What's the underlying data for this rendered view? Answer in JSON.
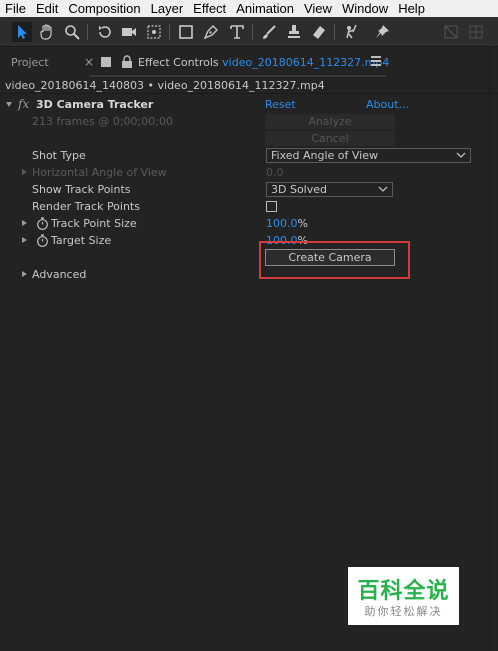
{
  "menu": [
    "File",
    "Edit",
    "Composition",
    "Layer",
    "Effect",
    "Animation",
    "View",
    "Window",
    "Help"
  ],
  "toolbar": {
    "tools": [
      "selection-tool",
      "hand-tool",
      "zoom-tool",
      "rotate-tool",
      "camera-tool",
      "pan-behind-tool",
      "rectangle-tool",
      "pen-tool",
      "type-tool",
      "brush-tool",
      "clone-stamp-tool",
      "eraser-tool",
      "roto-brush-tool",
      "puppet-pin-tool"
    ]
  },
  "tabs": {
    "project": "Project",
    "effect_controls_prefix": "Effect Controls ",
    "effect_controls_file": "video_20180614_112327.mp4"
  },
  "breadcrumb": "video_20180614_140803 • video_20180614_112327.mp4",
  "effect": {
    "name": "3D Camera Tracker",
    "reset": "Reset",
    "about": "About...",
    "status": "213 frames @ 0;00;00;00",
    "analyze": "Analyze",
    "cancel": "Cancel",
    "shot_type_label": "Shot Type",
    "shot_type_value": "Fixed Angle of View",
    "hfov_label": "Horizontal Angle of View",
    "hfov_value": "0.0",
    "show_track_points_label": "Show Track Points",
    "show_track_points_value": "3D Solved",
    "render_track_points_label": "Render Track Points",
    "render_track_points_checked": false,
    "track_point_size_label": "Track Point Size",
    "track_point_size_value": "100.0",
    "target_size_label": "Target Size",
    "target_size_value": "100.0",
    "percent": "%",
    "create_camera": "Create Camera",
    "advanced": "Advanced"
  },
  "watermark": {
    "main": "百科全说",
    "sub": "助你轻松解决"
  },
  "colors": {
    "accent_blue": "#2d8ceb",
    "highlight_red": "#d23c3c",
    "watermark_green": "#27b24a"
  }
}
